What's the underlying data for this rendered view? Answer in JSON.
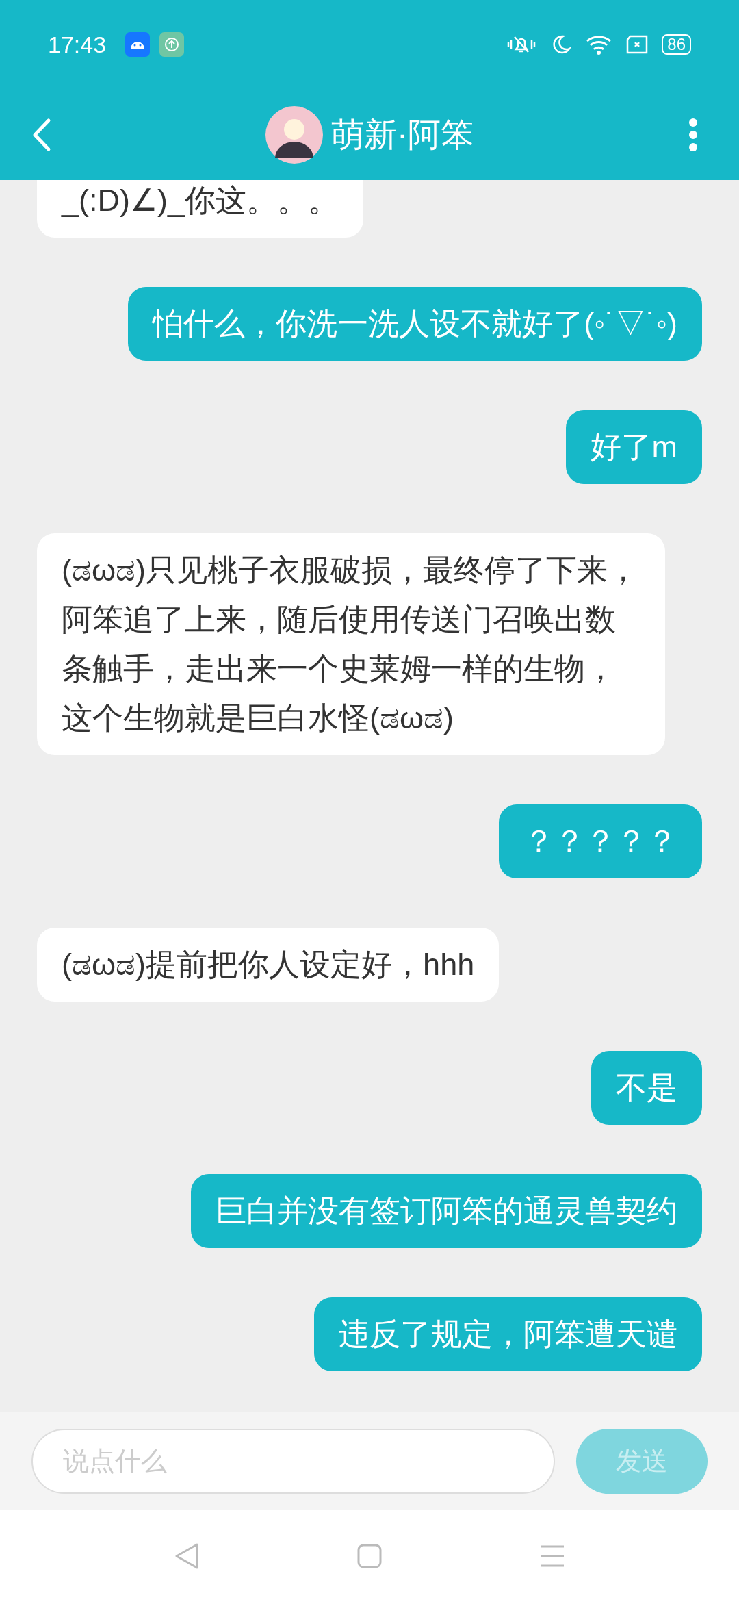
{
  "status_bar": {
    "time": "17:43",
    "battery": "86"
  },
  "header": {
    "title": "萌新·阿笨"
  },
  "messages": [
    {
      "kind": "incoming",
      "text": "_(:D)∠)_你这。。。"
    },
    {
      "kind": "outgoing",
      "text": "怕什么，你洗一洗人设不就好了(◦˙▽˙◦)"
    },
    {
      "kind": "outgoing",
      "text": "好了m"
    },
    {
      "kind": "incoming",
      "text": "(ಡωಡ)只见桃子衣服破损，最终停了下来，阿笨追了上来，随后使用传送门召唤出数条触手，走出来一个史莱姆一样的生物，这个生物就是巨白水怪(ಡωಡ)"
    },
    {
      "kind": "outgoing",
      "text": "？？？？？"
    },
    {
      "kind": "incoming",
      "text": "(ಡωಡ)提前把你人设定好，hhh"
    },
    {
      "kind": "outgoing",
      "text": "不是"
    },
    {
      "kind": "outgoing",
      "text": "巨白并没有签订阿笨的通灵兽契约"
    },
    {
      "kind": "outgoing",
      "text": "违反了规定，阿笨遭天谴"
    }
  ],
  "composer": {
    "placeholder": "说点什么",
    "send": "发送",
    "disabled": true
  }
}
